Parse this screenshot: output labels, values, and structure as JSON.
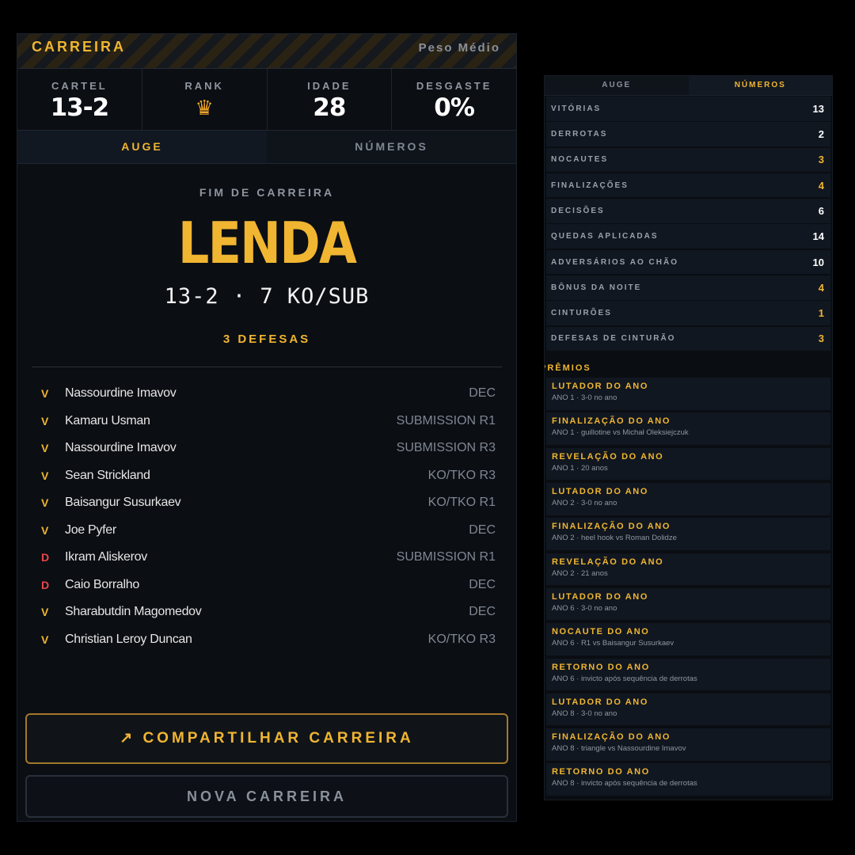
{
  "career": {
    "title": "CARREIRA",
    "weight_class": "Peso Médio"
  },
  "stats": [
    {
      "label": "CARTEL",
      "value": "13-2"
    },
    {
      "label": "RANK",
      "icon": "crown-icon"
    },
    {
      "label": "IDADE",
      "value": "28"
    },
    {
      "label": "DESGASTE",
      "value": "0%"
    }
  ],
  "tabs": [
    {
      "label": "AUGE",
      "active": true
    },
    {
      "label": "NÚMEROS",
      "active": false
    }
  ],
  "summary": {
    "end_label": "FIM DE CARREIRA",
    "title": "LENDA",
    "record_line": "13-2 · 7 KO/SUB",
    "defenses": "3 DEFESAS"
  },
  "fights": [
    {
      "result": "V",
      "opponent": "Nassourdine Imavov",
      "method": "DEC"
    },
    {
      "result": "V",
      "opponent": "Kamaru Usman",
      "method": "SUBMISSION R1"
    },
    {
      "result": "V",
      "opponent": "Nassourdine Imavov",
      "method": "SUBMISSION R3"
    },
    {
      "result": "V",
      "opponent": "Sean Strickland",
      "method": "KO/TKO R3"
    },
    {
      "result": "V",
      "opponent": "Baisangur Susurkaev",
      "method": "KO/TKO R1"
    },
    {
      "result": "V",
      "opponent": "Joe Pyfer",
      "method": "DEC"
    },
    {
      "result": "D",
      "opponent": "Ikram Aliskerov",
      "method": "SUBMISSION R1"
    },
    {
      "result": "D",
      "opponent": "Caio Borralho",
      "method": "DEC"
    },
    {
      "result": "V",
      "opponent": "Sharabutdin Magomedov",
      "method": "DEC"
    },
    {
      "result": "V",
      "opponent": "Christian Leroy Duncan",
      "method": "KO/TKO R3"
    }
  ],
  "buttons": {
    "share": "↗ COMPARTILHAR CARREIRA",
    "new": "NOVA CARREIRA"
  },
  "panel": {
    "tabs": [
      {
        "label": "AUGE",
        "active": false
      },
      {
        "label": "NÚMEROS",
        "active": true
      }
    ],
    "stats": [
      {
        "label": "VITÓRIAS",
        "value": "13",
        "highlight": false
      },
      {
        "label": "DERROTAS",
        "value": "2",
        "highlight": false
      },
      {
        "label": "NOCAUTES",
        "value": "3",
        "highlight": true
      },
      {
        "label": "FINALIZAÇÕES",
        "value": "4",
        "highlight": true
      },
      {
        "label": "DECISÕES",
        "value": "6",
        "highlight": false
      },
      {
        "label": "QUEDAS APLICADAS",
        "value": "14",
        "highlight": false
      },
      {
        "label": "ADVERSÁRIOS AO CHÃO",
        "value": "10",
        "highlight": false
      },
      {
        "label": "BÔNUS DA NOITE",
        "value": "4",
        "highlight": true
      },
      {
        "label": "CINTURÕES",
        "value": "1",
        "highlight": true
      },
      {
        "label": "DEFESAS DE CINTURÃO",
        "value": "3",
        "highlight": true
      }
    ],
    "awards_title": "PRÊMIOS",
    "awards": [
      {
        "title": "LUTADOR DO ANO",
        "detail": "ANO 1 · 3-0 no ano"
      },
      {
        "title": "FINALIZAÇÃO DO ANO",
        "detail": "ANO 1 · guillotine vs Michał Oleksiejczuk"
      },
      {
        "title": "REVELAÇÃO DO ANO",
        "detail": "ANO 1 · 20 anos"
      },
      {
        "title": "LUTADOR DO ANO",
        "detail": "ANO 2 · 3-0 no ano"
      },
      {
        "title": "FINALIZAÇÃO DO ANO",
        "detail": "ANO 2 · heel hook vs Roman Dolidze"
      },
      {
        "title": "REVELAÇÃO DO ANO",
        "detail": "ANO 2 · 21 anos"
      },
      {
        "title": "LUTADOR DO ANO",
        "detail": "ANO 6 · 3-0 no ano"
      },
      {
        "title": "NOCAUTE DO ANO",
        "detail": "ANO 6 · R1 vs Baisangur Susurkaev"
      },
      {
        "title": "RETORNO DO ANO",
        "detail": "ANO 6 · invicto após sequência de derrotas"
      },
      {
        "title": "LUTADOR DO ANO",
        "detail": "ANO 8 · 3-0 no ano"
      },
      {
        "title": "FINALIZAÇÃO DO ANO",
        "detail": "ANO 8 · triangle vs Nassourdine Imavov"
      },
      {
        "title": "RETORNO DO ANO",
        "detail": "ANO 8 · invicto após sequência de derrotas"
      }
    ]
  }
}
